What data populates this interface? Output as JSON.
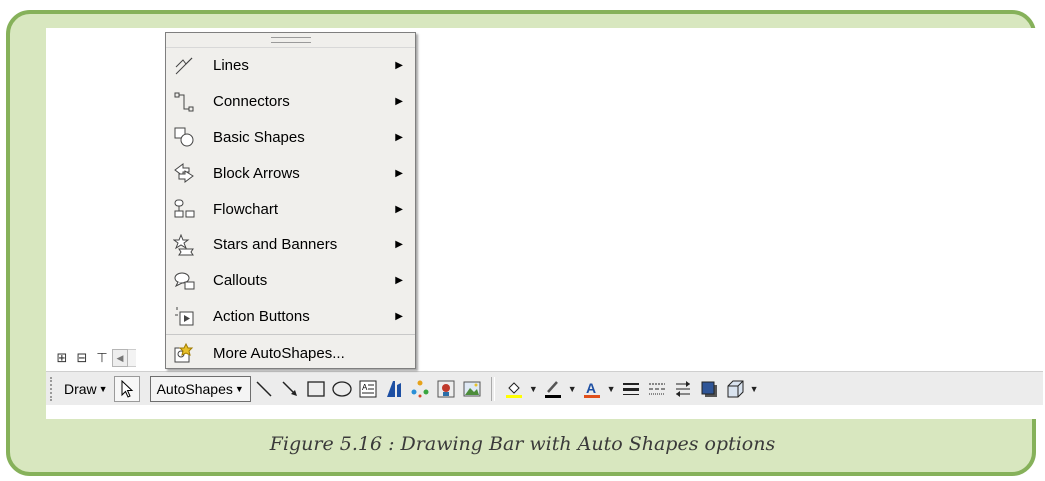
{
  "menu": {
    "items": [
      {
        "label": "Lines",
        "icon": "lines-icon",
        "submenu": true
      },
      {
        "label": "Connectors",
        "icon": "connectors-icon",
        "submenu": true
      },
      {
        "label": "Basic Shapes",
        "icon": "basic-shapes-icon",
        "submenu": true
      },
      {
        "label": "Block Arrows",
        "icon": "block-arrows-icon",
        "submenu": true
      },
      {
        "label": "Flowchart",
        "icon": "flowchart-icon",
        "submenu": true
      },
      {
        "label": "Stars and Banners",
        "icon": "stars-banners-icon",
        "submenu": true
      },
      {
        "label": "Callouts",
        "icon": "callouts-icon",
        "submenu": true
      },
      {
        "label": "Action Buttons",
        "icon": "action-buttons-icon",
        "submenu": true
      },
      {
        "label": "More AutoShapes...",
        "icon": "more-autoshapes-icon",
        "submenu": false
      }
    ]
  },
  "toolbar": {
    "draw_label": "Draw",
    "autoshapes_label": "AutoShapes",
    "icons": [
      "line-icon",
      "arrow-icon",
      "rectangle-icon",
      "oval-icon",
      "text-box-icon",
      "wordart-icon",
      "diagram-icon",
      "clip-art-icon",
      "picture-icon",
      "fill-color-icon",
      "line-color-icon",
      "font-color-icon",
      "line-style-icon",
      "dash-style-icon",
      "arrow-style-icon",
      "shadow-style-icon",
      "3d-style-icon"
    ]
  },
  "colors": {
    "frame_border": "#86b15a",
    "frame_fill": "#d8e7bf",
    "font_color_bar": "#e0501c",
    "fill_color_bar": "#ffff00"
  },
  "caption": "Figure 5.16 : Drawing Bar with Auto Shapes  options"
}
